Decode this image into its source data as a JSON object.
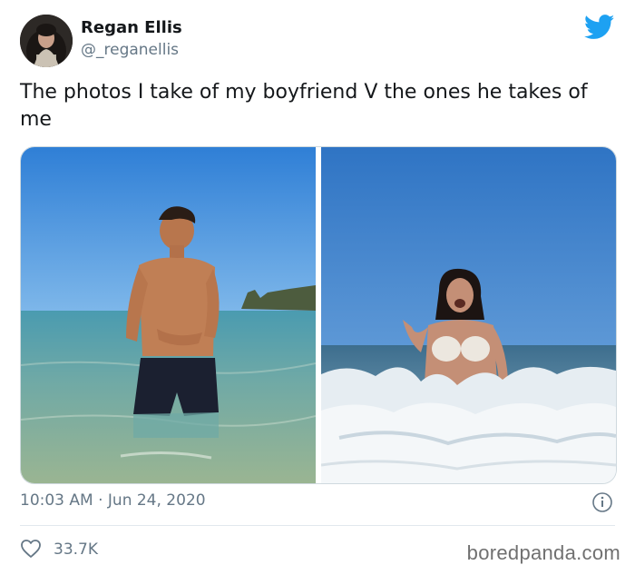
{
  "author": {
    "display_name": "Regan Ellis",
    "handle": "@_reganellis",
    "avatar_icon": "user-avatar"
  },
  "tweet": {
    "text": "The photos I take of my boyfriend V the ones he takes of me",
    "timestamp": "10:03 AM · Jun 24, 2020"
  },
  "media": {
    "photo_left_subject": "boyfriend-in-sea-photo",
    "photo_right_subject": "girlfriend-in-waves-photo"
  },
  "engagement": {
    "likes": "33.7K",
    "like_icon": "heart-icon",
    "info_icon": "info-icon"
  },
  "branding": {
    "platform_icon": "twitter-bird-icon",
    "platform_color": "#1da1f2",
    "watermark": "boredpanda.com"
  },
  "colors": {
    "text_primary": "#14171a",
    "text_secondary": "#657786",
    "divider": "#e1e8ed"
  }
}
